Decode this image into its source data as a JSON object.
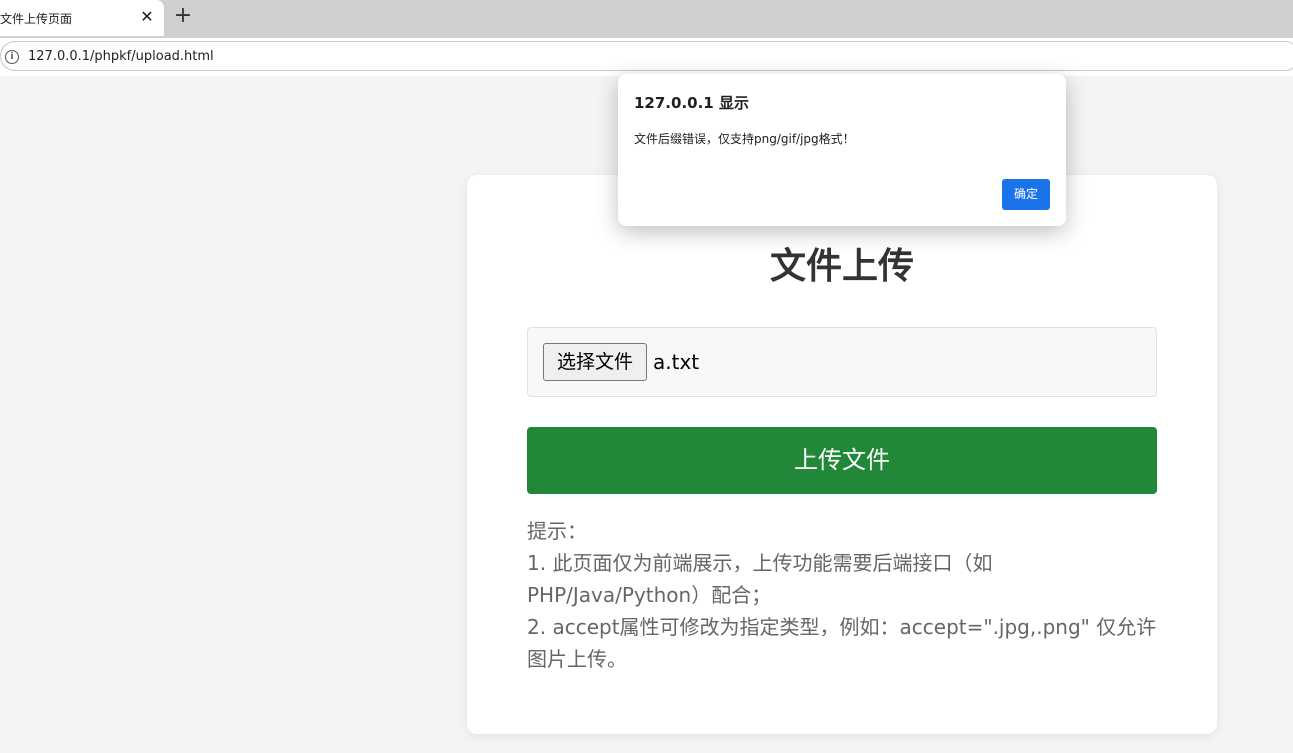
{
  "browser": {
    "tab_title": "文件上传页面",
    "tab_close": "✕",
    "new_tab": "+",
    "url": "127.0.0.1/phpkf/upload.html",
    "info_icon": "i"
  },
  "page": {
    "title": "文件上传",
    "file_button_label": "选择文件",
    "file_name": "a.txt",
    "upload_button_label": "上传文件",
    "tips": [
      "提示：",
      "1. 此页面仅为前端展示，上传功能需要后端接口（如PHP/Java/Python）配合；",
      "2. accept属性可修改为指定类型，例如：accept=\".jpg,.png\" 仅允许图片上传。"
    ]
  },
  "dialog": {
    "title": "127.0.0.1 显示",
    "message": "文件后缀错误，仅支持png/gif/jpg格式！",
    "ok_label": "确定"
  },
  "colors": {
    "upload_button": "#218838",
    "dialog_ok": "#1a73e8",
    "background": "#f4f4f4"
  }
}
